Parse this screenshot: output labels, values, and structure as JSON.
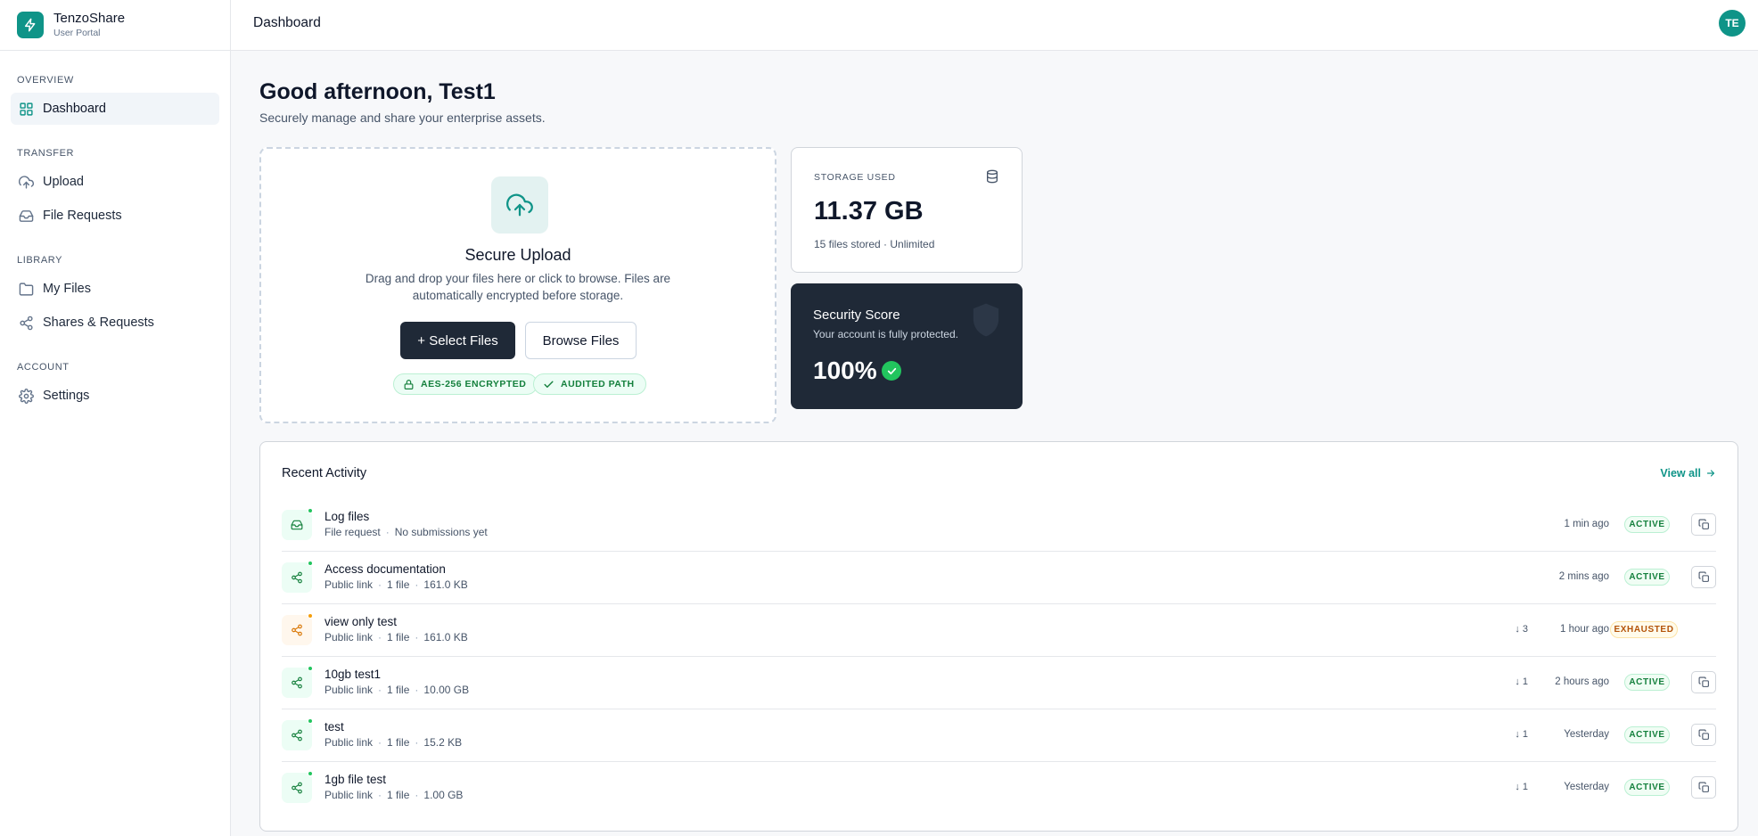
{
  "brand": {
    "name": "TenzoShare",
    "subtitle": "User Portal"
  },
  "sidebar": {
    "sections": [
      {
        "title": "OVERVIEW",
        "items": [
          {
            "label": "Dashboard",
            "icon": "grid-icon",
            "active": true
          }
        ]
      },
      {
        "title": "TRANSFER",
        "items": [
          {
            "label": "Upload",
            "icon": "cloud-upload-icon"
          },
          {
            "label": "File Requests",
            "icon": "inbox-icon"
          }
        ]
      },
      {
        "title": "LIBRARY",
        "items": [
          {
            "label": "My Files",
            "icon": "folder-icon"
          },
          {
            "label": "Shares & Requests",
            "icon": "share-icon"
          }
        ]
      },
      {
        "title": "ACCOUNT",
        "items": [
          {
            "label": "Settings",
            "icon": "gear-icon"
          }
        ]
      }
    ]
  },
  "header": {
    "title": "Dashboard",
    "avatar_initials": "TE"
  },
  "greeting": {
    "title": "Good afternoon, Test1",
    "subtitle": "Securely manage and share your enterprise assets."
  },
  "upload": {
    "title": "Secure Upload",
    "description": "Drag and drop your files here or click to browse. Files are automatically encrypted before storage.",
    "primary_button": "+ Select Files",
    "secondary_button": "Browse Files",
    "badges": [
      "AES-256 ENCRYPTED",
      "AUDITED PATH"
    ]
  },
  "storage": {
    "label": "STORAGE USED",
    "value": "11.37 GB",
    "subtitle": "15 files stored · Unlimited"
  },
  "security": {
    "title": "Security Score",
    "subtitle": "Your account is fully protected.",
    "value": "100%"
  },
  "activity": {
    "title": "Recent Activity",
    "view_all": "View all",
    "rows": [
      {
        "name": "Log files",
        "meta": [
          "File request",
          "No submissions yet"
        ],
        "downloads": "",
        "time": "1 min ago",
        "status": "ACTIVE",
        "icon": "inbox-icon"
      },
      {
        "name": "Access documentation",
        "meta": [
          "Public link",
          "1 file",
          "161.0 KB"
        ],
        "downloads": "",
        "time": "2 mins ago",
        "status": "ACTIVE",
        "icon": "share-icon"
      },
      {
        "name": "view only test",
        "meta": [
          "Public link",
          "1 file",
          "161.0 KB"
        ],
        "downloads": "↓ 3",
        "time": "1 hour ago",
        "status": "EXHAUSTED",
        "icon": "share-icon"
      },
      {
        "name": "10gb test1",
        "meta": [
          "Public link",
          "1 file",
          "10.00 GB"
        ],
        "downloads": "↓ 1",
        "time": "2 hours ago",
        "status": "ACTIVE",
        "icon": "share-icon"
      },
      {
        "name": "test",
        "meta": [
          "Public link",
          "1 file",
          "15.2 KB"
        ],
        "downloads": "↓ 1",
        "time": "Yesterday",
        "status": "ACTIVE",
        "icon": "share-icon"
      },
      {
        "name": "1gb file test",
        "meta": [
          "Public link",
          "1 file",
          "1.00 GB"
        ],
        "downloads": "↓ 1",
        "time": "Yesterday",
        "status": "ACTIVE",
        "icon": "share-icon"
      }
    ]
  },
  "colors": {
    "accent": "#0f9488",
    "dark": "#1f2937",
    "success": "#22c55e",
    "warning": "#f59e0b"
  }
}
